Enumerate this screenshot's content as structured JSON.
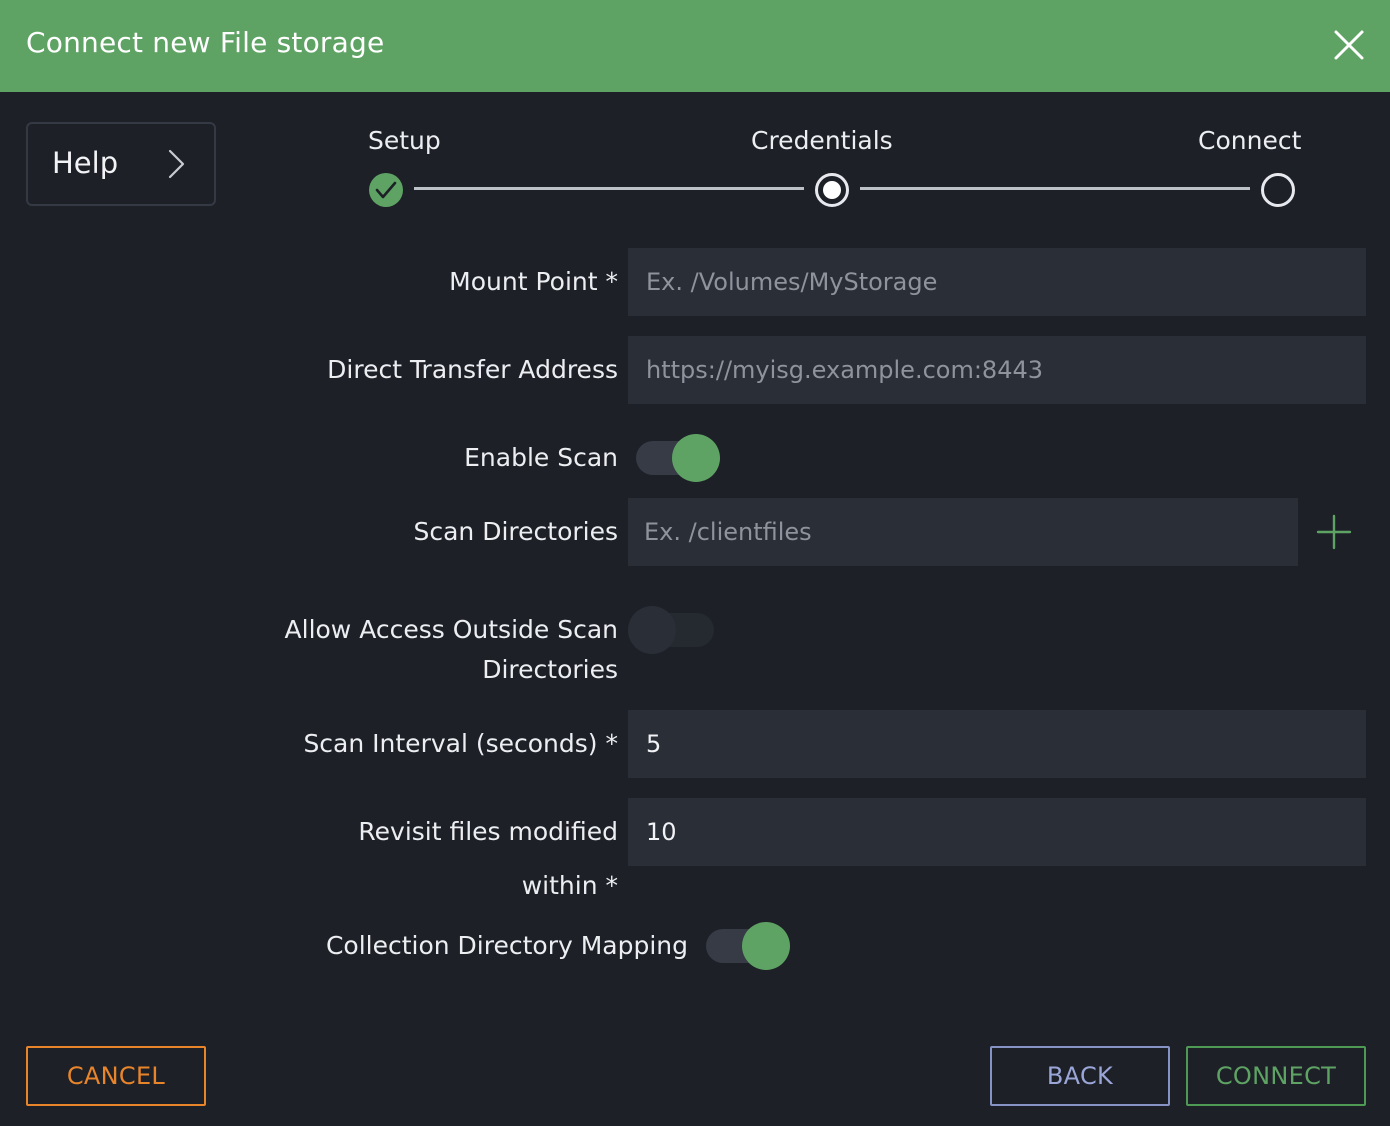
{
  "header": {
    "title": "Connect new File storage",
    "close_icon": "close-icon",
    "color": "#5ea364"
  },
  "sidebar": {
    "help_label": "Help",
    "help_icon": "chevron-right-icon"
  },
  "stepper": {
    "steps": [
      {
        "label": "Setup",
        "state": "complete"
      },
      {
        "label": "Credentials",
        "state": "active"
      },
      {
        "label": "Connect",
        "state": "pending"
      }
    ]
  },
  "form": {
    "mount_point": {
      "label": "Mount Point *",
      "value": "",
      "placeholder": "Ex. /Volumes/MyStorage"
    },
    "direct_transfer_address": {
      "label": "Direct Transfer Address",
      "value": "",
      "placeholder": "https://myisg.example.com:8443"
    },
    "enable_scan": {
      "label": "Enable Scan",
      "on": true
    },
    "scan_directories": {
      "label": "Scan Directories",
      "value": "",
      "placeholder": "Ex. /clientfiles",
      "add_icon": "plus-icon"
    },
    "allow_access_outside": {
      "label_line1": "Allow Access Outside Scan",
      "label_line2": "Directories",
      "on": false
    },
    "scan_interval": {
      "label": "Scan Interval (seconds) *",
      "value": "5"
    },
    "revisit_files": {
      "label_line1": "Revisit files modified",
      "label_line2": "within *",
      "value": "10"
    },
    "collection_directory_mapping": {
      "label": "Collection Directory Mapping",
      "on": true
    }
  },
  "footer": {
    "cancel_label": "CANCEL",
    "back_label": "BACK",
    "connect_label": "CONNECT"
  },
  "colors": {
    "accent_green": "#5ea364",
    "cancel_orange": "#e8852b",
    "back_blue": "#8793c5",
    "background": "#1d2027"
  }
}
